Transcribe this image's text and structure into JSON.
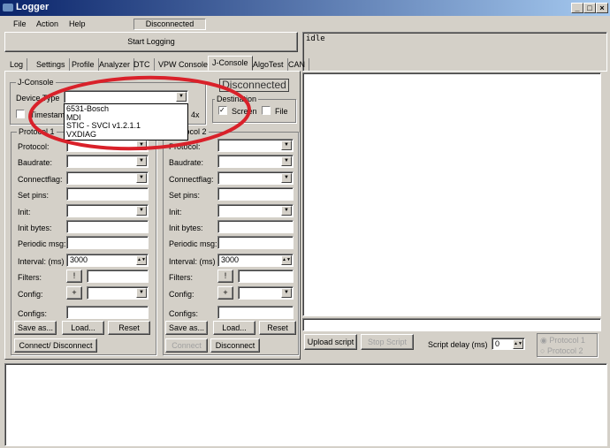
{
  "window": {
    "title": "Logger",
    "minimize": "_",
    "maximize": "□",
    "close": "×"
  },
  "menu": [
    "File",
    "Action",
    "Help"
  ],
  "status": "Disconnected",
  "start_logging": "Start Logging",
  "status_output": "idle",
  "tabs": [
    "Log",
    "Settings",
    "Profile",
    "Analyzer",
    "DTC",
    "VPW Console",
    "J-Console",
    "AlgoTest",
    "CAN"
  ],
  "active_tab": "J-Console",
  "jconsole": {
    "group_label": "J-Console",
    "device_type_label": "Device Type",
    "device_type_value": "",
    "device_options": [
      "6531-Bosch",
      "MDI",
      "STIC - SVCI v1.2.1.1",
      "VXDIAG"
    ],
    "timestamp_label": "Timestamp",
    "hidden_option_label": "4x",
    "connection_status": "Disconnected",
    "destination": {
      "label": "Destination",
      "screen": "Screen",
      "screen_checked": true,
      "file": "File",
      "file_checked": false
    }
  },
  "protocols": [
    {
      "label": "Protocol 1",
      "rows": [
        "Protocol:",
        "Baudrate:",
        "Connectflag:",
        "Set pins:",
        "Init:",
        "Init bytes:",
        "Periodic msg:",
        "Interval: (ms)",
        "Filters:",
        "Config:",
        "Configs:"
      ],
      "interval": "3000",
      "filters_button": "!",
      "config_button": "+",
      "save": "Save as...",
      "load": "Load...",
      "reset": "Reset",
      "connect": "Connect/ Disconnect"
    },
    {
      "label": "Protocol 2",
      "rows": [
        "Protocol:",
        "Baudrate:",
        "Connectflag:",
        "Set pins:",
        "Init:",
        "Init bytes:",
        "Periodic msg:",
        "Interval: (ms)",
        "Filters:",
        "Config:",
        "Configs:"
      ],
      "interval": "3000",
      "filters_button": "!",
      "config_button": "+",
      "save": "Save as...",
      "load": "Load...",
      "reset": "Reset",
      "connect": "Connect",
      "disconnect": "Disconnect"
    }
  ],
  "script": {
    "upload": "Upload script",
    "stop": "Stop Script",
    "delay_label": "Script delay (ms)",
    "delay_value": "0",
    "radio1": "Protocol 1",
    "radio2": "Protocol 2"
  },
  "colors": {
    "annotation": "#d9212a",
    "titlebar": "#0a246a"
  }
}
